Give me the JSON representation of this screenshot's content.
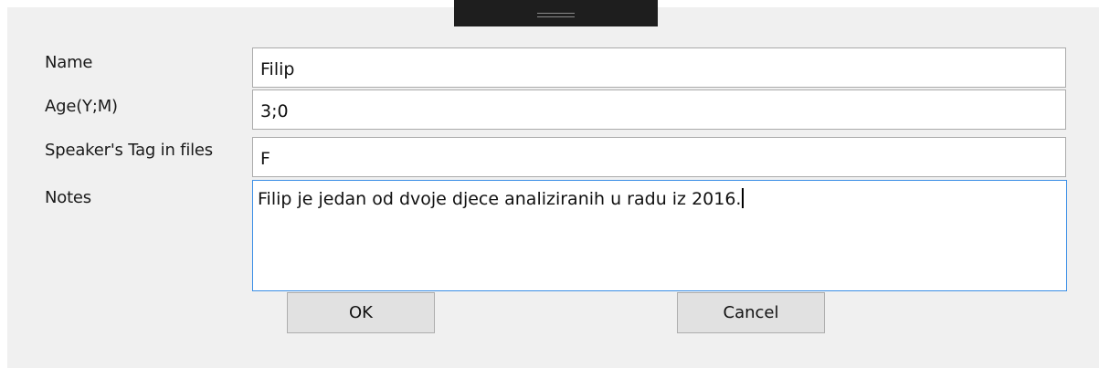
{
  "form": {
    "name_label": "Name",
    "name_value": "Filip",
    "age_label": "Age(Y;M)",
    "age_value": "3;0",
    "tag_label": "Speaker's Tag in files",
    "tag_value": "F",
    "notes_label": "Notes",
    "notes_value": "Filip je jedan od dvoje djece analiziranih u radu iz 2016."
  },
  "buttons": {
    "ok_label": "OK",
    "cancel_label": "Cancel"
  },
  "colors": {
    "dialog_background": "#f0f0f0",
    "focus_border": "#3a8ee6",
    "title_grip": "#1e1e1e"
  }
}
